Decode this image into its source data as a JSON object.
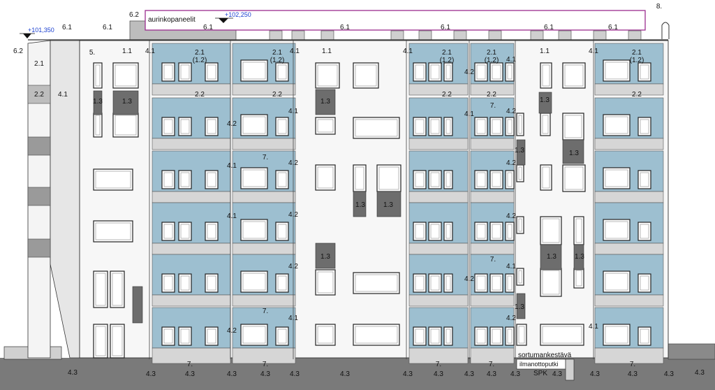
{
  "labels": {
    "solar_panels": "aurinkopaneelit",
    "level_left": "+101,350",
    "level_roof": "+102,250",
    "fence_label": "sortumankestävä",
    "intake_label": "ilmanottoputki",
    "spk_label": "SPK",
    "l_2_1": "2.1",
    "l_2_1_sub": "(1.2)",
    "l_2_2": "2.2",
    "l_1_1": "1.1",
    "l_1_3": "1.3",
    "l_4_1": "4.1",
    "l_4_2": "4.2",
    "l_4_3": "4.3",
    "l_5": "5.",
    "l_6_1": "6.1",
    "l_6_2": "6.2",
    "l_7": "7.",
    "l_8": "8."
  },
  "colors": {
    "balcony_blue": "#9dbfd0",
    "balcony_slab": "#d6d6d6",
    "dark_panel": "#6d6d6d",
    "mid_panel": "#9a9a9a",
    "ground": "#7a7a7a",
    "solar_outline": "#9b2d8f",
    "level_marker": "#1a3fd0"
  }
}
